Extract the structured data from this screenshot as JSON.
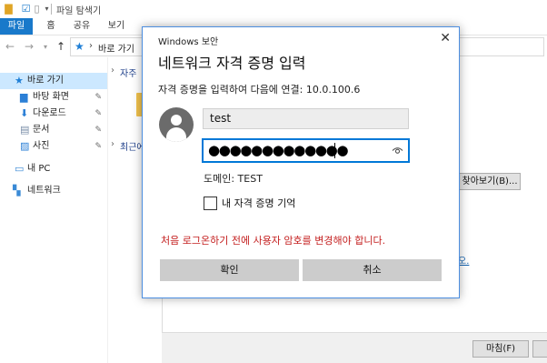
{
  "explorer": {
    "title": "파일 탐색기",
    "ribbon_tabs": [
      "파일",
      "홈",
      "공유",
      "보기"
    ],
    "address_crumb": "바로 가기",
    "sidebar": {
      "quick_access": "바로 가기",
      "items": [
        "바탕 화면",
        "다운로드",
        "문서",
        "사진"
      ],
      "this_pc": "내 PC",
      "network": "네트워크"
    },
    "groups": {
      "frequent": "자주",
      "recent": "최근에"
    },
    "browse_button": "찾아보기(B)...",
    "link_fragment": "오.",
    "finish_button": "마침(F)"
  },
  "dialog": {
    "caption": "Windows 보안",
    "heading": "네트워크 자격 증명 입력",
    "connect_text": "자격 증명을 입력하여 다음에 연결: 10.0.100.6",
    "username": "test",
    "password_mask": "●●●●●●●●●●●●●",
    "domain_text": "도메인: TEST",
    "remember_label": "내 자격 증명 기억",
    "remember_checked": false,
    "warning": "처음 로그온하기 전에 사용자 암호를 변경해야 합니다.",
    "ok_button": "확인",
    "cancel_button": "취소",
    "colors": {
      "accent": "#0078d7",
      "warning": "#c42020",
      "button": "#cccccc"
    }
  }
}
